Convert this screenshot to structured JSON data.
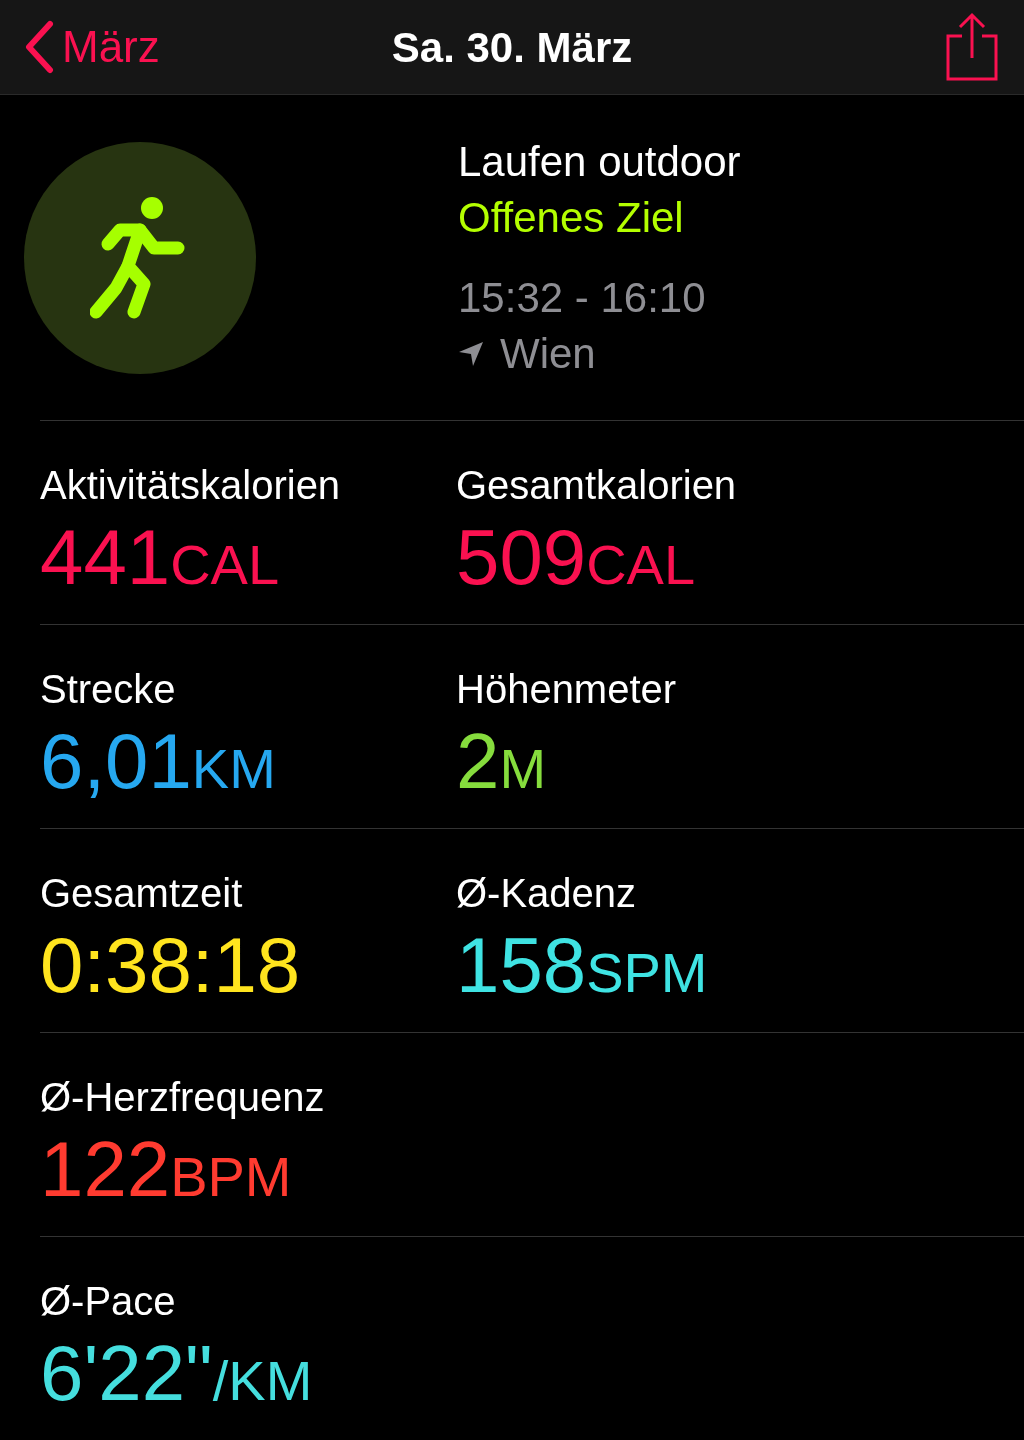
{
  "nav": {
    "back": "März",
    "title": "Sa. 30. März"
  },
  "workout": {
    "name": "Laufen outdoor",
    "goal": "Offenes Ziel",
    "time": "15:32 - 16:10",
    "location": "Wien"
  },
  "metrics": [
    {
      "cells": [
        {
          "label": "Aktivitätskalorien",
          "value": "441",
          "unit": "CAL",
          "color": "#fa1150"
        },
        {
          "label": "Gesamtkalorien",
          "value": "509",
          "unit": "CAL",
          "color": "#fa1150"
        }
      ]
    },
    {
      "cells": [
        {
          "label": "Strecke",
          "value": "6,01",
          "unit": "KM",
          "color": "#26a8f0"
        },
        {
          "label": "Höhenmeter",
          "value": "2",
          "unit": "M",
          "color": "#86dc3d"
        }
      ]
    },
    {
      "cells": [
        {
          "label": "Gesamtzeit",
          "value": "0:38:18",
          "color": "#ffe41e"
        },
        {
          "label": "Ø-Kadenz",
          "value": "158",
          "unit": "SPM",
          "color": "#3fe3e3"
        }
      ]
    },
    {
      "cells": [
        {
          "label": "Ø-Herzfrequenz",
          "value": "122",
          "unit": "BPM",
          "color": "#ff3b30"
        }
      ]
    },
    {
      "cells": [
        {
          "label": "Ø-Pace",
          "value": "6'22\"",
          "unit": "/KM",
          "color": "#45dede"
        }
      ]
    }
  ]
}
